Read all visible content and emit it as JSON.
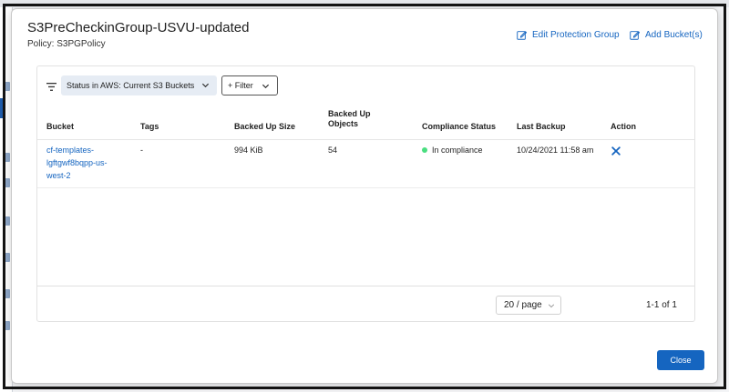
{
  "modal": {
    "title": "S3PreCheckinGroup-USVU-updated",
    "subtitle": "Policy: S3PGPolicy",
    "edit_link": "Edit Protection Group",
    "add_link": "Add Bucket(s)",
    "close_label": "Close"
  },
  "toolbar": {
    "status_filter": "Status in AWS: Current S3 Buckets",
    "add_filter": "+ Filter"
  },
  "table": {
    "columns": {
      "bucket": "Bucket",
      "tags": "Tags",
      "backed_up_size": "Backed Up Size",
      "backed_up_objects": "Backed Up Objects",
      "compliance_status": "Compliance Status",
      "last_backup": "Last Backup",
      "action": "Action"
    },
    "rows": [
      {
        "bucket": "cf-templates-lgftgwf8bqpp-us-west-2",
        "tags": "-",
        "backed_up_size": "994 KiB",
        "backed_up_objects": "54",
        "compliance_status": "In compliance",
        "last_backup": "10/24/2021 11:58 am"
      }
    ]
  },
  "pagination": {
    "page_size": "20 / page",
    "range": "1-1 of 1"
  },
  "colors": {
    "accent": "#1565c0",
    "compliance_ok": "#4ade80"
  },
  "icons": {
    "edit": "edit-icon",
    "add": "add-bucket-icon",
    "filter": "filter-lines-icon",
    "chevron": "chevron-down-icon",
    "remove": "close-x-icon"
  }
}
